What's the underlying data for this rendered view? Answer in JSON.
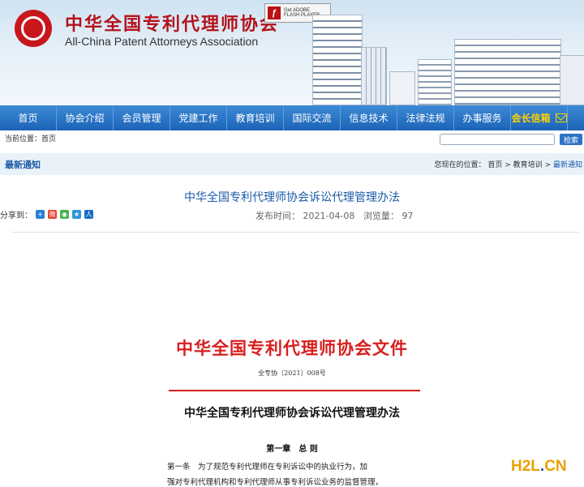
{
  "header": {
    "site_name_cn": "中华全国专利代理师协会",
    "site_name_en": "All-China Patent Attorneys Association",
    "flash_badge_line1": "Get ADOBE",
    "flash_badge_line2": "FLASH PLAYER"
  },
  "nav": {
    "items": [
      "首页",
      "协会介绍",
      "会员管理",
      "党建工作",
      "教育培训",
      "国际交流",
      "信息技术",
      "法律法规",
      "办事服务"
    ],
    "mailbox_label": "会长信箱"
  },
  "location": {
    "label": "当前位置：首页",
    "search_button": "检索",
    "search_value": ""
  },
  "section": {
    "title": "最新通知",
    "breadcrumb_prefix": "您现在的位置：",
    "breadcrumb_home": "首页",
    "breadcrumb_sep": ">",
    "breadcrumb_cat": "教育培训",
    "breadcrumb_current": "最新通知"
  },
  "article": {
    "title": "中华全国专利代理师协会诉讼代理管理办法",
    "share_label": "分享到：",
    "published_label": "发布时间：",
    "published_date": "2021-04-08",
    "views_label": "浏览量：",
    "views": "97"
  },
  "document": {
    "header": "中华全国专利代理师协会文件",
    "number": "全专协〔2021〕008号",
    "title": "中华全国专利代理师协会诉讼代理管理办法",
    "chapter": "第一章　总 则",
    "line1": "第一条　为了规范专利代理师在专利诉讼中的执业行为，加",
    "line2": "强对专利代理机构和专利代理师从事专利诉讼业务的监督管理，"
  },
  "watermark": {
    "left": "H2L",
    "dot": ".",
    "right": "CN"
  },
  "colors": {
    "brand_red": "#c8161d",
    "nav_blue": "#1b63b7",
    "link_blue": "#1a5aa8",
    "mailbox_yellow": "#ffd200"
  }
}
